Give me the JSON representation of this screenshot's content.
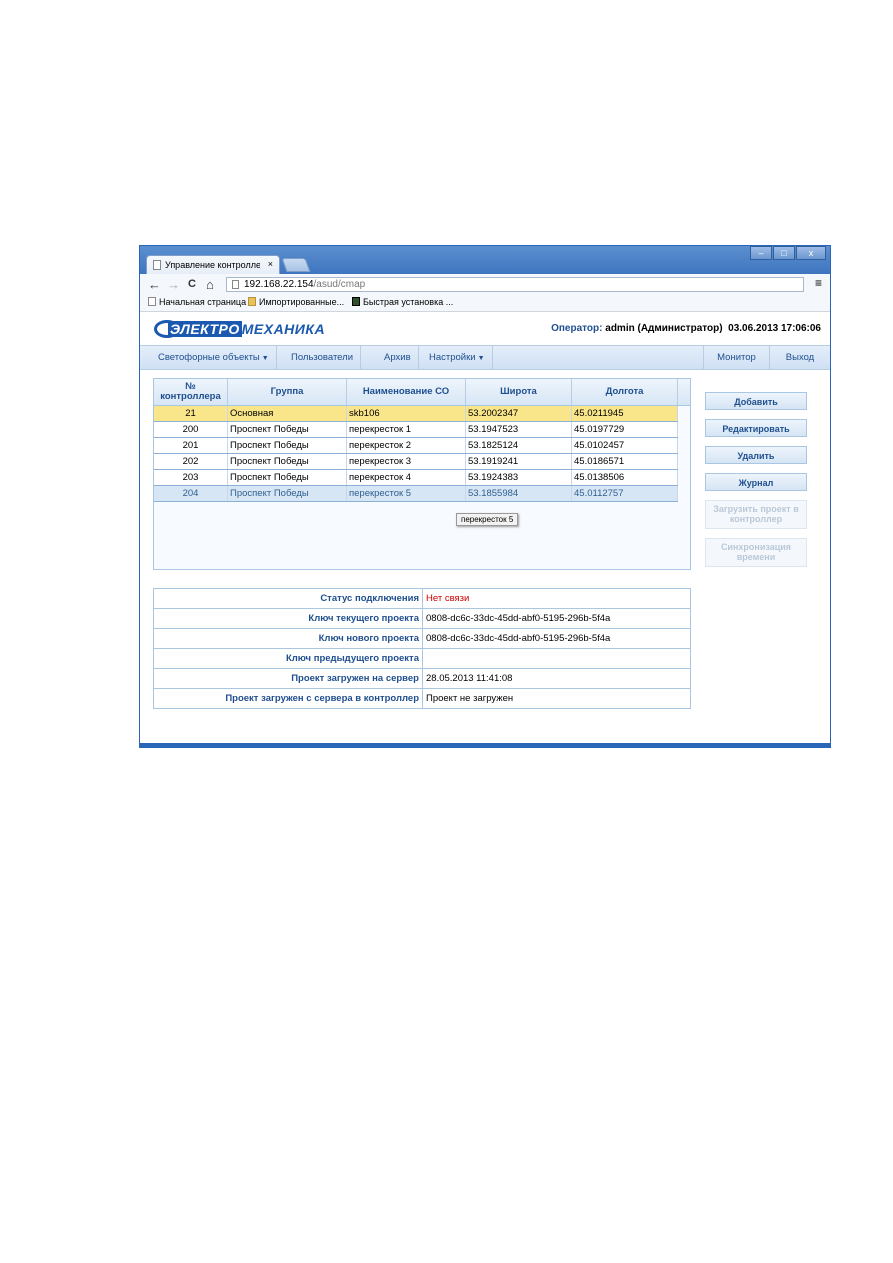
{
  "browser": {
    "tab_title": "Управление контроллер",
    "tab_close": "×",
    "url_host": "192.168.22.154",
    "url_path": "/asud/cmap",
    "nav_back": "←",
    "nav_forward": "→",
    "nav_reload": "C",
    "nav_home": "⌂",
    "menu": "≡",
    "win_min": "–",
    "win_max": "□",
    "win_close": "x",
    "bookmarks": [
      "Начальная страница",
      "Импортированные...",
      "Быстрая установка ..."
    ]
  },
  "header": {
    "logo_part1": "ЭЛЕКТРО",
    "logo_part2": "МЕХАНИКА",
    "operator_label": "Оператор:",
    "operator_user": "admin (Администратор)",
    "datetime": "03.06.2013 17:06:06"
  },
  "nav": {
    "items": [
      "Светофорные объекты",
      "Пользователи",
      "Архив",
      "Настройки"
    ],
    "caret": "▼",
    "monitor": "Монитор",
    "exit": "Выход"
  },
  "grid": {
    "columns": [
      "№ контроллера",
      "Группа",
      "Наименование СО",
      "Широта",
      "Долгота"
    ],
    "rows": [
      [
        "21",
        "Основная",
        "skb106",
        "53.2002347",
        "45.0211945"
      ],
      [
        "200",
        "Проспект Победы",
        "перекресток 1",
        "53.1947523",
        "45.0197729"
      ],
      [
        "201",
        "Проспект Победы",
        "перекресток 2",
        "53.1825124",
        "45.0102457"
      ],
      [
        "202",
        "Проспект Победы",
        "перекресток 3",
        "53.1919241",
        "45.0186571"
      ],
      [
        "203",
        "Проспект Победы",
        "перекресток 4",
        "53.1924383",
        "45.0138506"
      ],
      [
        "204",
        "Проспект Победы",
        "перекресток 5",
        "53.1855984",
        "45.0112757"
      ]
    ],
    "tooltip": "перекресток 5"
  },
  "actions": {
    "add": "Добавить",
    "edit": "Редактировать",
    "delete": "Удалить",
    "journal": "Журнал",
    "upload_l1": "Загрузить проект в",
    "upload_l2": "контроллер",
    "sync_l1": "Синхронизация",
    "sync_l2": "времени"
  },
  "info": {
    "rows": [
      {
        "label": "Статус подключения",
        "value": "Нет связи"
      },
      {
        "label": "Ключ текущего проекта",
        "value": "0808-dc6c-33dc-45dd-abf0-5195-296b-5f4a"
      },
      {
        "label": "Ключ нового проекта",
        "value": "0808-dc6c-33dc-45dd-abf0-5195-296b-5f4a"
      },
      {
        "label": "Ключ предыдущего проекта",
        "value": ""
      },
      {
        "label": "Проект загружен на сервер",
        "value": "28.05.2013 11:41:08"
      },
      {
        "label": "Проект загружен с сервера в контроллер",
        "value": "Проект не загружен"
      }
    ]
  },
  "colors": {
    "accent": "#1f4f8f",
    "selected_row": "#fae68a",
    "error": "#d00000"
  }
}
